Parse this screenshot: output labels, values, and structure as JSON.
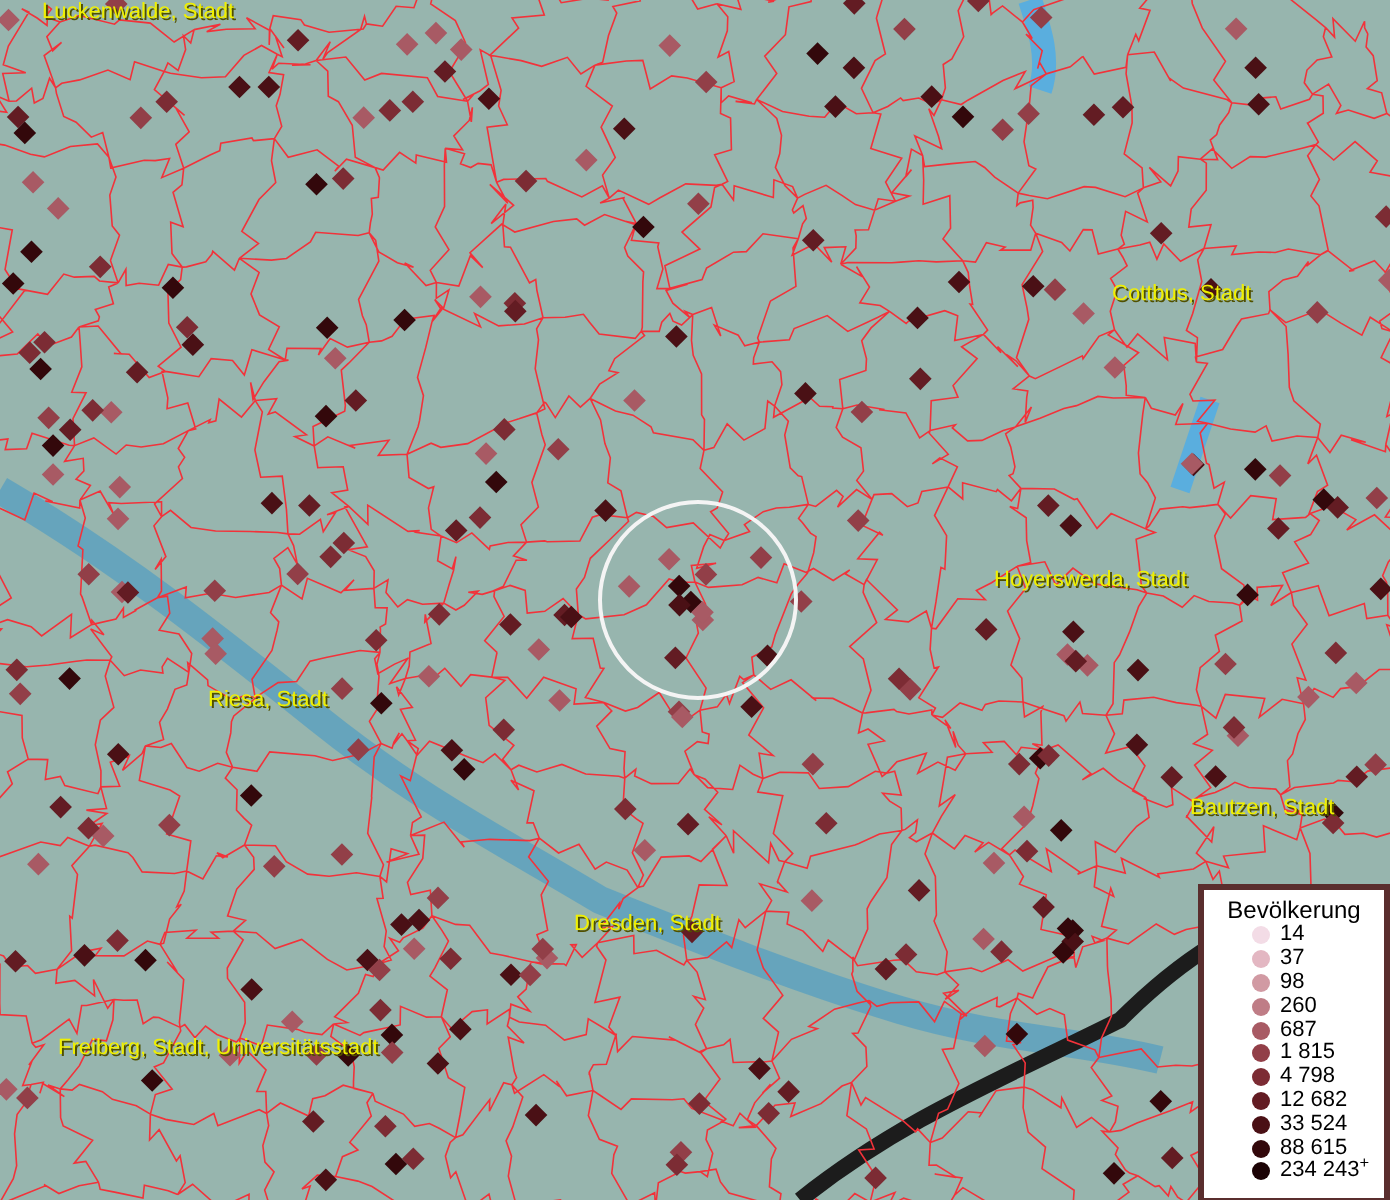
{
  "map": {
    "cities": [
      {
        "name": "Luckenwalde, Stadt"
      },
      {
        "name": "Cottbus, Stadt"
      },
      {
        "name": "Hoyerswerda, Stadt"
      },
      {
        "name": "Riesa, Stadt"
      },
      {
        "name": "Bautzen, Stadt"
      },
      {
        "name": "Dresden, Stadt"
      },
      {
        "name": "Freiberg, Stadt, Universitätsstadt"
      }
    ]
  },
  "legend": {
    "title": "Bevölkerung",
    "items": [
      {
        "label": "14",
        "color": "#f3dce6"
      },
      {
        "label": "37",
        "color": "#e3b7c2"
      },
      {
        "label": "98",
        "color": "#d19aa3"
      },
      {
        "label": "260",
        "color": "#bf7d86"
      },
      {
        "label": "687",
        "color": "#a85a64"
      },
      {
        "label": "1 815",
        "color": "#923f48"
      },
      {
        "label": "4 798",
        "color": "#7c2c34"
      },
      {
        "label": "12 682",
        "color": "#631c23"
      },
      {
        "label": "33 524",
        "color": "#4a1015"
      },
      {
        "label": "88 615",
        "color": "#33080b"
      },
      {
        "label": "234 243$^{+}$",
        "color": "#1c0305"
      }
    ]
  }
}
